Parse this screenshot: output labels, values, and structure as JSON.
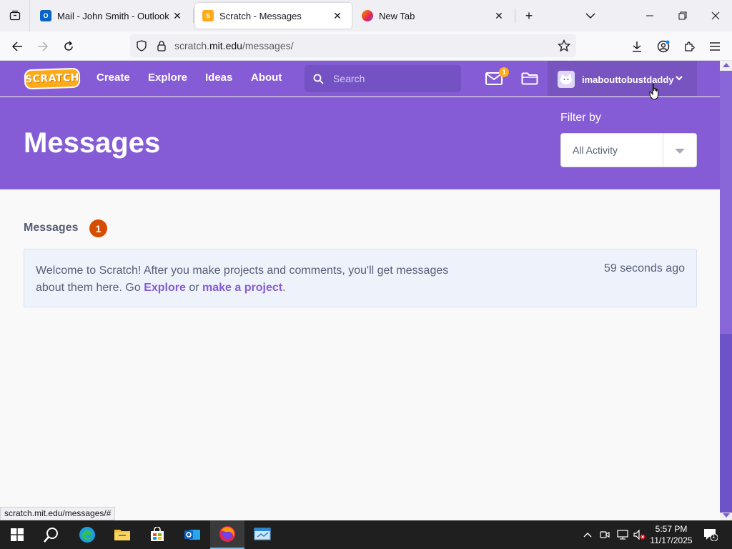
{
  "browser": {
    "tabs": [
      {
        "title": "Mail - John Smith - Outlook",
        "favicon": "outlook-icon",
        "active": false
      },
      {
        "title": "Scratch - Messages",
        "favicon": "scratch-icon",
        "active": true
      },
      {
        "title": "New Tab",
        "favicon": "firefox-icon",
        "active": false
      }
    ],
    "url_prefix": "scratch.",
    "url_host": "mit.edu",
    "url_path": "/messages/"
  },
  "scratch": {
    "logo_text": "SCRATCH",
    "nav": [
      "Create",
      "Explore",
      "Ideas",
      "About"
    ],
    "search_placeholder": "Search",
    "message_notification_count": "1",
    "username": "imabouttobustdaddy"
  },
  "banner": {
    "title": "Messages",
    "filter_label": "Filter by",
    "filter_value": "All Activity"
  },
  "messages": {
    "section_title": "Messages",
    "count": "1",
    "items": [
      {
        "text_before": "Welcome to Scratch! After you make projects and comments, you'll get messages about them here. Go ",
        "link1": "Explore",
        "text_middle": " or ",
        "link2": "make a project",
        "text_after": ".",
        "time": "59 seconds ago"
      }
    ]
  },
  "status_bar_url": "scratch.mit.edu/messages/#",
  "taskbar": {
    "time": "5:57 PM",
    "date": "11/17/2025",
    "notification_count": "1"
  },
  "colors": {
    "scratch_purple": "#855cd6",
    "badge_orange": "#d64d00",
    "notify_yellow": "#ffab1a"
  }
}
